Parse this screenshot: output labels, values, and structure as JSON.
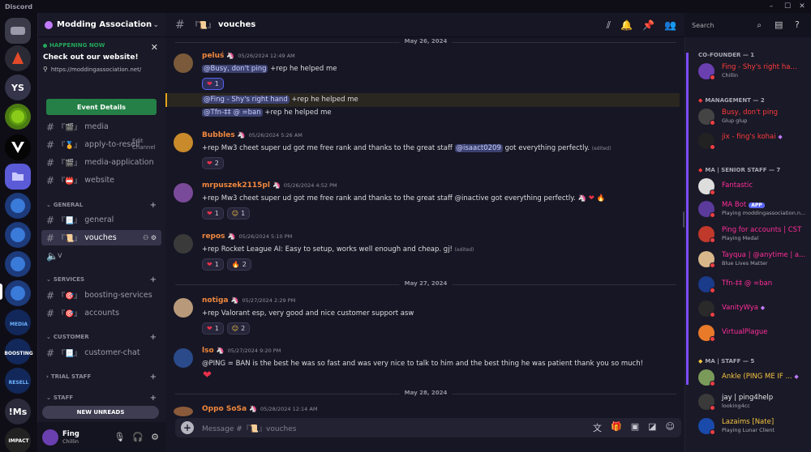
{
  "window": {
    "app_title": "Discord",
    "min": "–",
    "max": "☐",
    "close": "✕"
  },
  "server": {
    "name": "Modding Association",
    "chevron": "⌄"
  },
  "rail": {
    "ys_label": "YS",
    "media_label": "MEDIA",
    "boosting_label": "BOOSTING",
    "resell_label": "RESELL",
    "ms_label": "!Ms",
    "impact_label": "IMPACT"
  },
  "happening": {
    "title": "HAPPENING NOW",
    "headline": "Check out our website!",
    "link": "https://moddingassociation.net/",
    "button": "Event Details",
    "close": "✕"
  },
  "channels": {
    "media": "media",
    "apply": "apply-to-resell",
    "media_app": "media-application",
    "website": "website",
    "edit_tip": "Edit Channel",
    "cat_general": "GENERAL",
    "general": "general",
    "vouches": "vouches",
    "voice_v": "v",
    "cat_services": "SERVICES",
    "boosting": "boosting-services",
    "accounts": "accounts",
    "cat_customer": "CUSTOMER",
    "customer_chat": "customer-chat",
    "cat_trial": "TRIAL STAFF",
    "cat_staff": "STAFF",
    "new_unreads": "NEW UNREADS"
  },
  "user": {
    "name": "Fing",
    "status": "Chillin"
  },
  "header": {
    "channel": "vouches",
    "search_placeholder": "Search"
  },
  "messages": {
    "date1": "May 26, 2024",
    "date2": "May 27, 2024",
    "date3": "May 28, 2024",
    "m1_author": "peluś",
    "m1_ts": "05/26/2024 12:49 AM",
    "m1_line1_mention": "@Busy, don't ping",
    "m1_line1_text": "+rep he helped me",
    "m1_react_count": "1",
    "m1_line2_mention": "@Fing - Shy's right hand",
    "m1_line2_text": "+rep he helped me",
    "m1_line3_mention": "@Tfn-‡‡ @ =ban",
    "m1_line3_text": "+rep he helped me",
    "m2_author": "Bubbles",
    "m2_ts": "05/26/2024 5:26 AM",
    "m2_text": "+rep Mw3 cheet super ud got me free rank and thanks to the great staff",
    "m2_mention": "@isaact0209",
    "m2_text2": "got everything perfectly.",
    "m2_edited": "(edited)",
    "m2_react_count": "2",
    "m3_author": "mrpuszek2115pl",
    "m3_ts": "05/26/2024 4:52 PM",
    "m3_text": "+rep Mw3 cheet super ud got me free rank and thanks to the great staff @inactive got everything perfectly.",
    "m3_r1": "1",
    "m3_r2": "1",
    "m4_author": "repos",
    "m4_ts": "05/26/2024 5:10 PM",
    "m4_text": "+rep Rocket League AI:  Easy to setup, works well enough and cheap. gj!",
    "m4_edited": "(edited)",
    "m4_r1": "1",
    "m4_r2": "2",
    "m5_author": "notiga",
    "m5_ts": "05/27/2024 2:29 PM",
    "m5_text": "+rep Valorant esp, very good and nice customer support asw",
    "m5_r1": "1",
    "m5_r2": "2",
    "m6_author": "lso",
    "m6_ts": "05/27/2024 9:20 PM",
    "m6_text": "@PING = BAN is the best he was so fast and was very nice to talk to him and the best thing he was patient thank you so much!",
    "m7_author": "Oppo SoSa",
    "m7_ts": "05/28/2024 12:14 AM"
  },
  "composer": {
    "placeholder": "Message #『📜』vouches"
  },
  "members": {
    "cat_cofounder": "CO-FOUNDER — 1",
    "cat_management": "MANAGEMENT — 2",
    "cat_senior": "MA | SENIOR STAFF — 7",
    "cat_staff": "MA | STAFF — 5",
    "m_fing": "Fing - Shy's right ha...",
    "m_fing_status": "Chillin",
    "m_busy": "Busy, don't ping",
    "m_busy_status": "Glup glup",
    "m_jix": "jix - fing's kohai",
    "m_fantastic": "Fantastic",
    "m_mabot": "MA Bot",
    "m_mabot_app": "APP",
    "m_mabot_status": "Playing moddingassociation.n...",
    "m_ping": "Ping for accounts | CST",
    "m_ping_status": "Playing Medal",
    "m_tayqua": "Tayqua | @anytime | a...",
    "m_tayqua_status": "Blue Lives Matter",
    "m_tfn": "Tfn-‡‡ @ =ban",
    "m_vanity": "VanityWya",
    "m_virtual": "VirtualPlague",
    "m_ankle": "Ankle (PING ME IF ...",
    "m_jay": "jay | ping4help",
    "m_jay_status": "looking4cc",
    "m_lazaims": "Lazaims [Nate]",
    "m_lazaims_status": "Playing Lunar Client"
  },
  "colors": {
    "accent": "#5865f2",
    "pink_role": "#ff2e9a",
    "red_role": "#ff3b3b",
    "yellow_role": "#f5c542",
    "orange_author": "#f0883e"
  }
}
